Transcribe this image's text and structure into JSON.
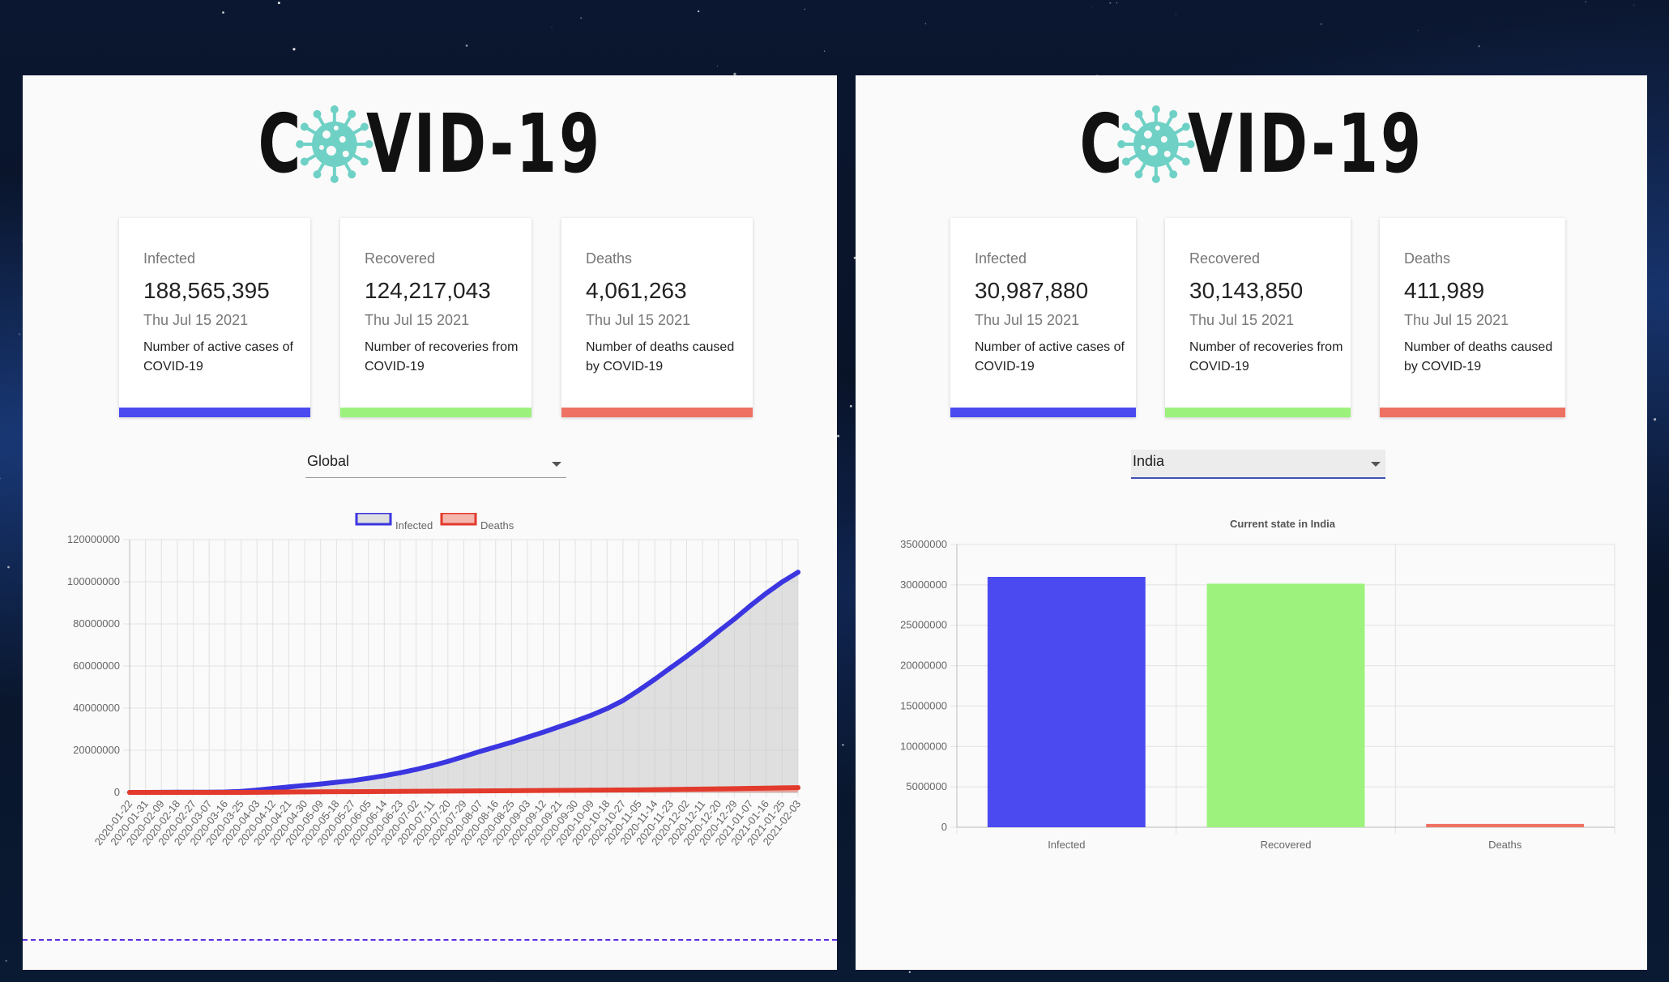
{
  "left_panel": {
    "logo_text_1": "C",
    "logo_text_2": "VID-19",
    "cards": [
      {
        "title": "Infected",
        "value": "188,565,395",
        "date": "Thu Jul 15 2021",
        "desc": "Number of active cases of COVID-19",
        "color": "#4a4af0"
      },
      {
        "title": "Recovered",
        "value": "124,217,043",
        "date": "Thu Jul 15 2021",
        "desc": "Number of recoveries from COVID-19",
        "color": "#9cf27c"
      },
      {
        "title": "Deaths",
        "value": "4,061,263",
        "date": "Thu Jul 15 2021",
        "desc": "Number of deaths caused by COVID-19",
        "color": "#ef7163"
      }
    ],
    "country_select": {
      "value": "Global"
    }
  },
  "right_panel": {
    "logo_text_1": "C",
    "logo_text_2": "VID-19",
    "cards": [
      {
        "title": "Infected",
        "value": "30,987,880",
        "date": "Thu Jul 15 2021",
        "desc": "Number of active cases of COVID-19",
        "color": "#4a4af0"
      },
      {
        "title": "Recovered",
        "value": "30,143,850",
        "date": "Thu Jul 15 2021",
        "desc": "Number of recoveries from COVID-19",
        "color": "#9cf27c"
      },
      {
        "title": "Deaths",
        "value": "411,989",
        "date": "Thu Jul 15 2021",
        "desc": "Number of deaths caused by COVID-19",
        "color": "#ef7163"
      }
    ],
    "country_select": {
      "value": "India"
    }
  },
  "chart_data": [
    {
      "type": "line",
      "title": "",
      "legend": [
        "Infected",
        "Deaths"
      ],
      "legend_position": "top",
      "grid": true,
      "ylim": [
        0,
        120000000
      ],
      "yticks": [
        0,
        20000000,
        40000000,
        60000000,
        80000000,
        100000000,
        120000000
      ],
      "x": [
        "2020-01-22",
        "2020-01-31",
        "2020-02-09",
        "2020-02-18",
        "2020-02-27",
        "2020-03-07",
        "2020-03-16",
        "2020-03-25",
        "2020-04-03",
        "2020-04-12",
        "2020-04-21",
        "2020-04-30",
        "2020-05-09",
        "2020-05-18",
        "2020-05-27",
        "2020-06-05",
        "2020-06-14",
        "2020-06-23",
        "2020-07-02",
        "2020-07-11",
        "2020-07-20",
        "2020-07-29",
        "2020-08-07",
        "2020-08-16",
        "2020-08-25",
        "2020-09-03",
        "2020-09-12",
        "2020-09-21",
        "2020-09-30",
        "2020-10-09",
        "2020-10-18",
        "2020-10-27",
        "2020-11-05",
        "2020-11-14",
        "2020-11-23",
        "2020-12-02",
        "2020-12-11",
        "2020-12-20",
        "2020-12-29",
        "2021-01-07",
        "2021-01-16",
        "2021-01-25",
        "2021-02-03"
      ],
      "series": [
        {
          "name": "Infected",
          "color": "#3b36e0",
          "fill": "rgba(200,200,200,0.55)",
          "values": [
            600,
            10000,
            40000,
            75000,
            83000,
            110000,
            190000,
            500000,
            1100000,
            1900000,
            2600000,
            3300000,
            4000000,
            4800000,
            5600000,
            6700000,
            7900000,
            9300000,
            10900000,
            12700000,
            14700000,
            17000000,
            19400000,
            21600000,
            23800000,
            26200000,
            28600000,
            31200000,
            33800000,
            36600000,
            39800000,
            43600000,
            48500000,
            53700000,
            59200000,
            64600000,
            70300000,
            76400000,
            82300000,
            88600000,
            94500000,
            99900000,
            104500000
          ]
        },
        {
          "name": "Deaths",
          "color": "#e23a2c",
          "fill": "rgba(239,113,99,0.5)",
          "values": [
            17,
            213,
            910,
            2000,
            2800,
            3500,
            7000,
            22000,
            58000,
            115000,
            180000,
            230000,
            275000,
            315000,
            350000,
            395000,
            430000,
            480000,
            520000,
            565000,
            615000,
            665000,
            725000,
            780000,
            830000,
            875000,
            920000,
            975000,
            1020000,
            1070000,
            1115000,
            1165000,
            1220000,
            1300000,
            1390000,
            1480000,
            1575000,
            1675000,
            1785000,
            1905000,
            2030000,
            2150000,
            2270000
          ]
        }
      ]
    },
    {
      "type": "bar",
      "title": "Current state in India",
      "categories": [
        "Infected",
        "Recovered",
        "Deaths"
      ],
      "values": [
        30987880,
        30143850,
        411989
      ],
      "colors": [
        "#4a4af0",
        "#9cf27c",
        "#ef7163"
      ],
      "ylim": [
        0,
        35000000
      ],
      "yticks": [
        0,
        5000000,
        10000000,
        15000000,
        20000000,
        25000000,
        30000000,
        35000000
      ],
      "grid": true
    }
  ]
}
